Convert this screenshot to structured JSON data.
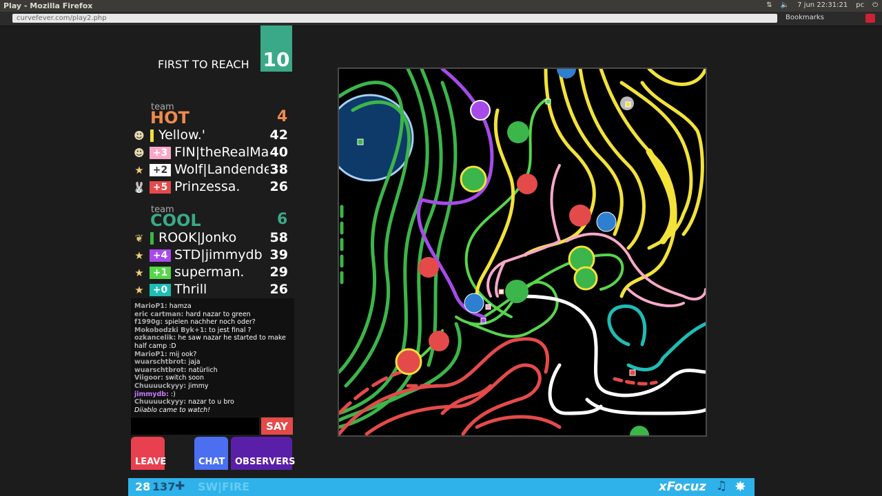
{
  "os": {
    "window_title": "Play - Mozilla Firefox",
    "clock": "7 jun 22:31:21",
    "user": "pc"
  },
  "browser": {
    "url": "curvefever.com/play2.php",
    "bookmarks_label": "Bookmarks"
  },
  "game_header": {
    "first_to_reach_label": "FIRST TO REACH",
    "target_score": "10"
  },
  "teams": [
    {
      "label": "team",
      "name": "HOT",
      "score": "4",
      "color": "#f08a4b",
      "players": [
        {
          "icon": "troll-face-icon",
          "badge": "",
          "name": "Yellow.'",
          "points": "42",
          "color": "#f2e23a"
        },
        {
          "icon": "troll-face-icon",
          "badge": "+3",
          "name": "FIN|theRealMa",
          "points": "40",
          "color": "#f7a8c8"
        },
        {
          "icon": "star-icon",
          "badge": "+2",
          "name": "Wolf|Landende",
          "points": "38",
          "color": "#ffffff"
        },
        {
          "icon": "bunny-icon",
          "badge": "+5",
          "name": "Prinzessa.",
          "points": "26",
          "color": "#e54a4a"
        }
      ]
    },
    {
      "label": "team",
      "name": "COOL",
      "score": "6",
      "color": "#3aa987",
      "players": [
        {
          "icon": "leaf-icon",
          "badge": "",
          "name": "ROOK|Jonko",
          "points": "58",
          "color": "#3cb54a"
        },
        {
          "icon": "star-icon",
          "badge": "+4",
          "name": "STD|jimmydb",
          "points": "39",
          "color": "#a64bea"
        },
        {
          "icon": "star-icon",
          "badge": "+1",
          "name": "superman.",
          "points": "29",
          "color": "#56d64a"
        },
        {
          "icon": "star-icon",
          "badge": "+0",
          "name": "Thrill",
          "points": "26",
          "color": "#1dbdb5"
        }
      ]
    }
  ],
  "chat": {
    "messages": [
      {
        "author": "MarioP1:",
        "text": " hamza"
      },
      {
        "author": "eric cartman:",
        "text": " hard nazar to green"
      },
      {
        "author": "f1990g:",
        "text": " spielen nachher noch oder?"
      },
      {
        "author": "Mokobodzki Byk+1:",
        "text": " to jest final ?"
      },
      {
        "author": "ozkancelik:",
        "text": " he saw nazar he started to make"
      },
      {
        "author": "",
        "text": "half camp :D"
      },
      {
        "author": "MarioP1:",
        "text": " mij ook?"
      },
      {
        "author": "wuarschtbrot:",
        "text": " jaja"
      },
      {
        "author": "wuarschtbrot:",
        "text": " natürlich"
      },
      {
        "author": "Viigoor:",
        "text": " switch soon"
      },
      {
        "author": "Chuuuuckyyy:",
        "text": " jimmy"
      },
      {
        "author": "jimmydb:",
        "text": " :)"
      },
      {
        "author": "Chuuuuckyyy:",
        "text": " nazar to u bro"
      }
    ],
    "system_message": "Diiablo came to watch!",
    "input_value": "",
    "say_label": "SAY"
  },
  "buttons": {
    "leave": "LEAVE",
    "chat": "CHAT",
    "observers": "OBSERVERS"
  },
  "status_bar": {
    "value_a": "28",
    "value_b": "137",
    "team_tag": "SW|FIRE",
    "username": "xFocuz",
    "icons": [
      "plus-icon",
      "music-note-icon",
      "star-burst-icon"
    ]
  }
}
